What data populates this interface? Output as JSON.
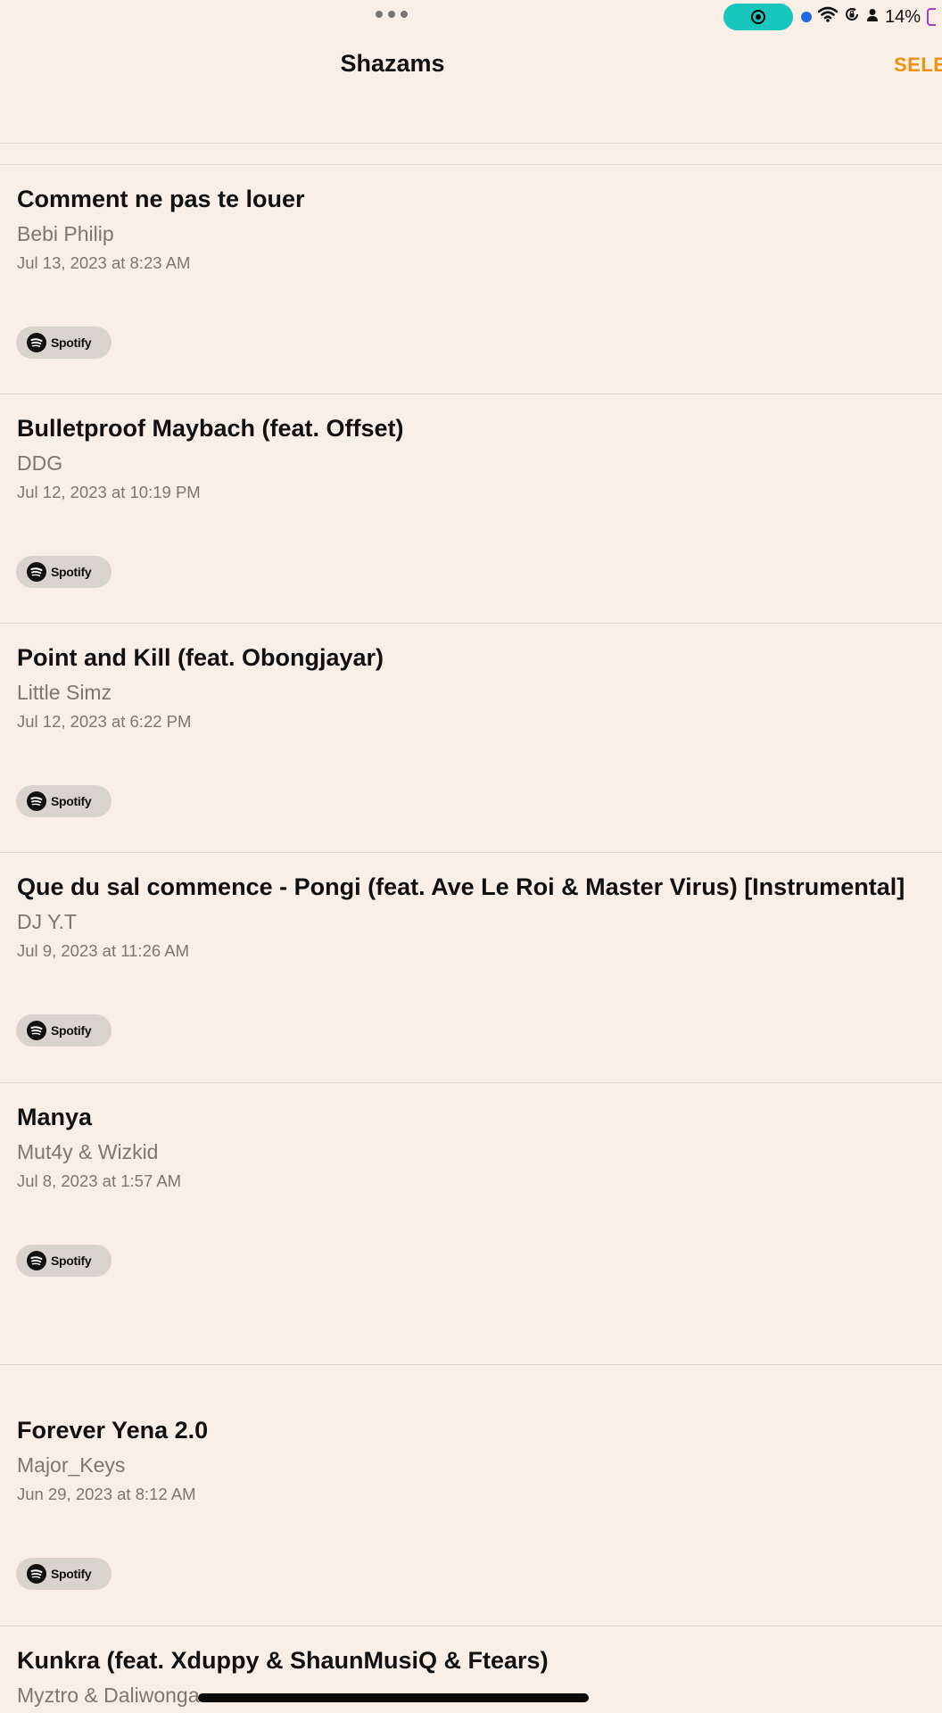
{
  "status_bar": {
    "battery_percent": "14%",
    "icons": [
      "multitask-dots-icon",
      "screen-record-icon",
      "location-dot-icon",
      "wifi-icon",
      "rotation-lock-icon",
      "person-icon",
      "battery-icon"
    ]
  },
  "nav": {
    "title": "Shazams",
    "select_label": "SELE"
  },
  "colors": {
    "background": "#f9efe6",
    "accent": "#f1900d",
    "record_pill": "#17c7bd"
  },
  "shazams": [
    {
      "title": "Comment ne pas te louer",
      "artist": "Bebi Philip",
      "date": "Jul 13, 2023 at 8:23 AM",
      "service": "Spotify"
    },
    {
      "title": "Bulletproof Maybach (feat. Offset)",
      "artist": "DDG",
      "date": "Jul 12, 2023 at 10:19 PM",
      "service": "Spotify"
    },
    {
      "title": "Point and Kill (feat. Obongjayar)",
      "artist": "Little Simz",
      "date": "Jul 12, 2023 at 6:22 PM",
      "service": "Spotify"
    },
    {
      "title": "Que du sal commence - Pongi (feat. Ave Le Roi & Master Virus) [Instrumental]",
      "artist": "DJ Y.T",
      "date": "Jul 9, 2023 at 11:26 AM",
      "service": "Spotify"
    },
    {
      "title": "Manya",
      "artist": "Mut4y & Wizkid",
      "date": "Jul 8, 2023 at 1:57 AM",
      "service": "Spotify"
    },
    {
      "title": "Forever Yena 2.0",
      "artist": "Major_Keys",
      "date": "Jun 29, 2023 at 8:12 AM",
      "service": "Spotify"
    },
    {
      "title": "Kunkra (feat. Xduppy & ShaunMusiQ & Ftears)",
      "artist": "Myztro & Daliwonga"
    }
  ]
}
